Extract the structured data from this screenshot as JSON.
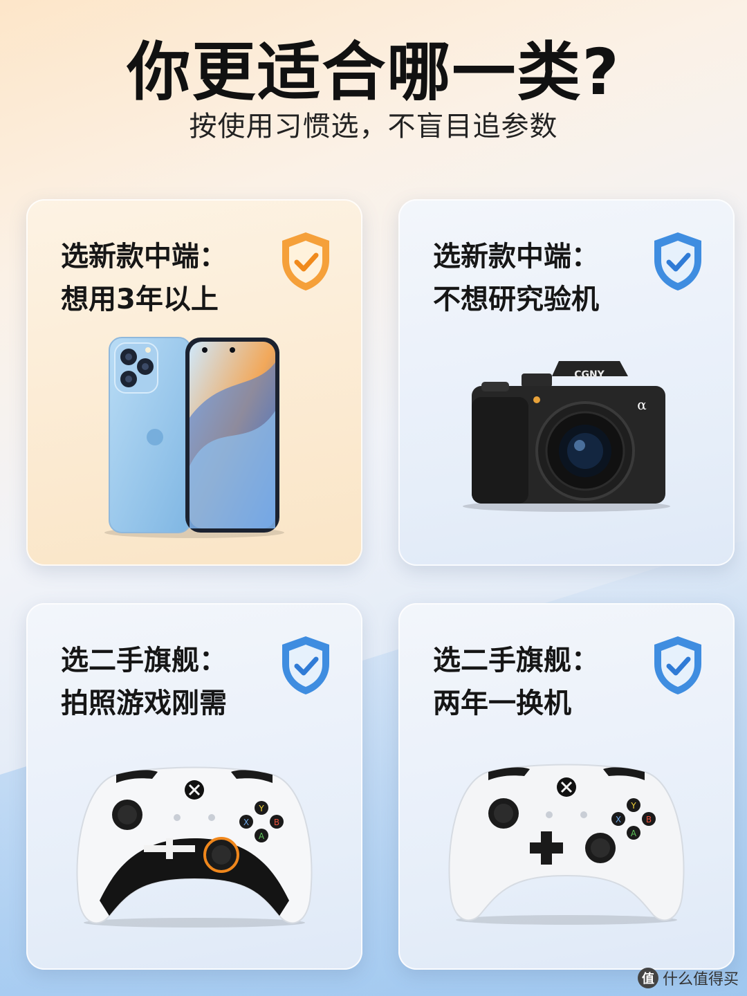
{
  "header": {
    "title": "你更适合哪一类?",
    "subtitle": "按使用习惯选，不盲目追参数"
  },
  "cards": [
    {
      "line1": "选新款中端：",
      "line2": "想用3年以上",
      "shield_color": "#f5a03a",
      "illustration": "smartphone"
    },
    {
      "line1": "选新款中端：",
      "line2": "不想研究验机",
      "shield_color": "#3f8de0",
      "illustration": "camera"
    },
    {
      "line1": "选二手旗舰：",
      "line2": "拍照游戏刚需",
      "shield_color": "#3f8de0",
      "illustration": "game-controller"
    },
    {
      "line1": "选二手旗舰：",
      "line2": "两年一换机",
      "shield_color": "#3f8de0",
      "illustration": "game-controller"
    }
  ],
  "camera_brand": "CGNY",
  "camera_badge": "α",
  "watermark": {
    "badge": "值",
    "text": "什么值得买"
  }
}
